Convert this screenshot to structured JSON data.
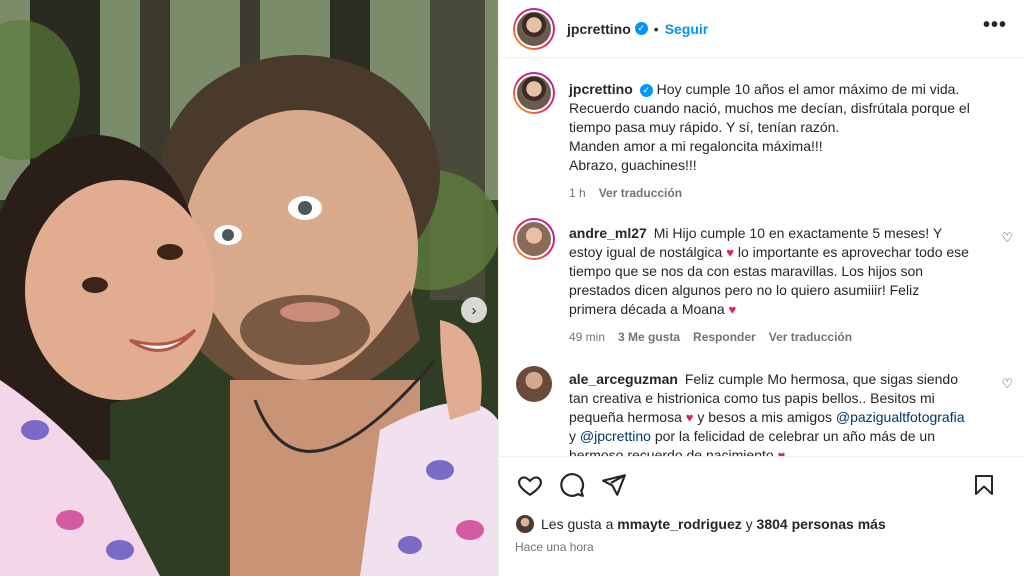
{
  "post": {
    "username": "jpcrettino",
    "verified_mark": "✓",
    "separator": "•",
    "follow_label": "Seguir",
    "more_label": "•••",
    "photo_alt": "Foto de jpcrettino con su hija",
    "next_label": "›"
  },
  "caption": {
    "username": "jpcrettino",
    "lines": [
      "Hoy cumple 10 años el amor máximo de mi vida.",
      "Recuerdo cuando nació, muchos me decían, disfrútala porque el tiempo pasa muy rápido. Y sí, tenían razón.",
      "Manden amor a mi regaloncita máxima!!!",
      "Abrazo, guachines!!!"
    ],
    "time": "1 h",
    "translate": "Ver traducción"
  },
  "comments": [
    {
      "username": "andre_ml27",
      "text_a": "Mi Hijo cumple 10 en exactamente 5 meses! Y estoy igual de nostálgica",
      "text_b": "lo importante es aprovechar todo ese tiempo que se nos da con estas maravillas. Los hijos son prestados dicen algunos pero no lo quiero asumiiir! Feliz primera década a Moana",
      "time": "49 min",
      "likes": "3 Me gusta",
      "reply": "Responder",
      "translate": "Ver traducción"
    },
    {
      "username": "ale_arceguzman",
      "text_a": "Feliz cumple Mo hermosa, que sigas siendo tan creativa e histrionica como tus papis bellos.. Besitos mi pequeña hermosa",
      "text_b": "y besos a mis amigos",
      "mention_1": "@pazigualtfotografia",
      "text_c": "y",
      "mention_2": "@jpcrettino",
      "text_d": "por la felicidad de celebrar un año más de un hermoso recuerdo de nacimiento"
    }
  ],
  "heart_glyph": "♥",
  "small_like_glyph": "♡",
  "likes": {
    "prefix": "Les gusta a",
    "user": "mmayte_rodriguez",
    "middle": "y",
    "count": "3804 personas más"
  },
  "timestamp": "Hace una hora",
  "icons": [
    "heart-icon",
    "comment-icon",
    "share-icon",
    "bookmark-icon",
    "verified-icon",
    "more-icon"
  ],
  "colors": {
    "link": "#0095f6",
    "heart": "#e0245e",
    "muted": "#737373",
    "mention": "#00376b"
  }
}
